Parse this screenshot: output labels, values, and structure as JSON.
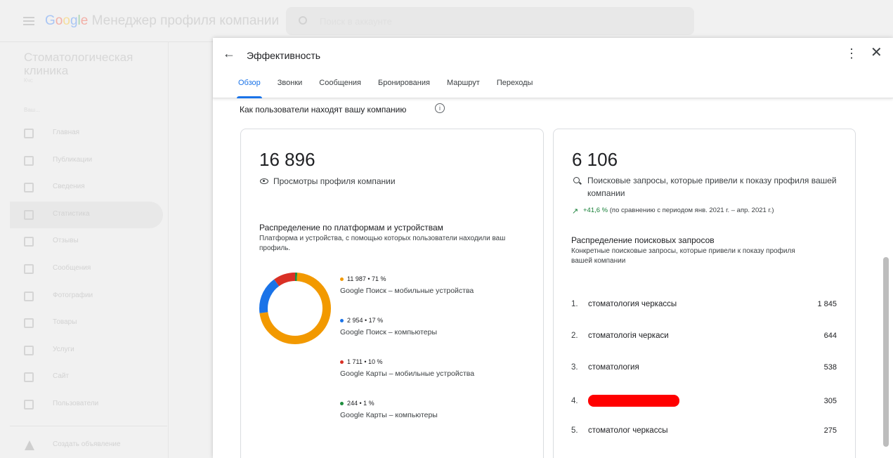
{
  "app": {
    "brand_google": "Google",
    "brand_rest": " Менеджер профиля компании",
    "search_placeholder": "Поиск в аккаунте"
  },
  "sidebar": {
    "business_name": "Стоматологическая клиника",
    "business_sub": "Кчс",
    "section_label": "Ваш...",
    "items": [
      {
        "label": "Главная",
        "icon": "home-icon"
      },
      {
        "label": "Публикации",
        "icon": "posts-icon"
      },
      {
        "label": "Сведения",
        "icon": "info-store-icon"
      },
      {
        "label": "Статистика",
        "icon": "insights-icon",
        "active": true
      },
      {
        "label": "Отзывы",
        "icon": "reviews-icon"
      },
      {
        "label": "Сообщения",
        "icon": "messages-icon"
      },
      {
        "label": "Фотографии",
        "icon": "photos-icon"
      },
      {
        "label": "Товары",
        "icon": "products-icon"
      },
      {
        "label": "Услуги",
        "icon": "services-icon"
      },
      {
        "label": "Сайт",
        "icon": "website-icon"
      },
      {
        "label": "Пользователи",
        "icon": "users-icon"
      }
    ],
    "ad_label": "Создать объявление"
  },
  "panel": {
    "title": "Эффективность",
    "tabs": [
      {
        "label": "Обзор",
        "active": true
      },
      {
        "label": "Звонки"
      },
      {
        "label": "Сообщения"
      },
      {
        "label": "Бронирования"
      },
      {
        "label": "Маршрут"
      },
      {
        "label": "Переходы"
      }
    ],
    "section_title": "Как пользователи находят вашу компанию",
    "left_card": {
      "value": "16 896",
      "label": "Просмотры профиля компании",
      "dist_title": "Распределение по платформам и устройствам",
      "dist_desc": "Платформа и устройства, с помощью которых пользователи находили ваш профиль.",
      "legend": [
        {
          "value": "11 987 • 71 %",
          "label": "Google Поиск – мобильные устройства",
          "color": "#f29900",
          "pct": 71
        },
        {
          "value": "2 954 • 17 %",
          "label": "Google Поиск – компьютеры",
          "color": "#1a73e8",
          "pct": 17
        },
        {
          "value": "1 711 • 10 %",
          "label": "Google Карты – мобильные устройства",
          "color": "#d93025",
          "pct": 10
        },
        {
          "value": "244 • 1 %",
          "label": "Google Карты – компьютеры",
          "color": "#1e8e3e",
          "pct": 1
        }
      ]
    },
    "right_card": {
      "value": "6 106",
      "label": "Поисковые запросы, которые привели к показу профиля вашей компании",
      "trend_pct": "+41,6 %",
      "trend_text": " (по сравнению с периодом янв. 2021 г. – апр. 2021 г.)",
      "dist_title": "Распределение поисковых запросов",
      "dist_desc": "Конкретные поисковые запросы, которые привели к показу профиля вашей компании",
      "queries": [
        {
          "idx": "1.",
          "text": "стоматология черкассы",
          "count": "1 845"
        },
        {
          "idx": "2.",
          "text": "стоматологія черкаси",
          "count": "644"
        },
        {
          "idx": "3.",
          "text": "стоматология",
          "count": "538"
        },
        {
          "idx": "4.",
          "text": "",
          "count": "305",
          "redacted": true
        },
        {
          "idx": "5.",
          "text": "стоматолог черкассы",
          "count": "275"
        }
      ]
    }
  }
}
